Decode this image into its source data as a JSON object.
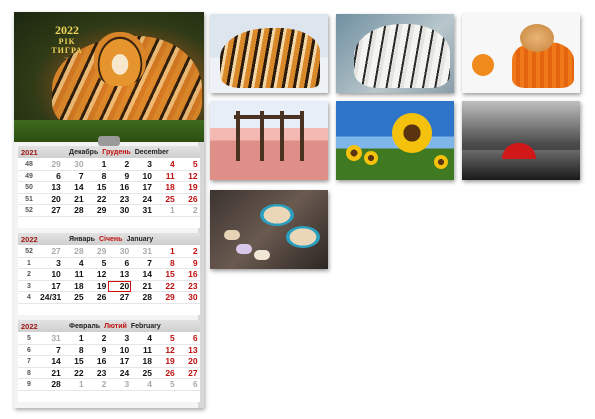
{
  "calendar": {
    "header": {
      "year": "2022",
      "line1": "РІК",
      "line2": "ТИГРА",
      "small": "~•~"
    },
    "months": [
      {
        "year": "2021",
        "name_ru": "Декабрь",
        "name_ua": "Грудень",
        "name_en": "December",
        "weeks": [
          {
            "week": "48",
            "days": [
              "29",
              "30",
              "1",
              "2",
              "3",
              "4",
              "5"
            ]
          },
          {
            "week": "49",
            "days": [
              "6",
              "7",
              "8",
              "9",
              "10",
              "11",
              "12"
            ]
          },
          {
            "week": "50",
            "days": [
              "13",
              "14",
              "15",
              "16",
              "17",
              "18",
              "19"
            ]
          },
          {
            "week": "51",
            "days": [
              "20",
              "21",
              "22",
              "23",
              "24",
              "25",
              "26"
            ]
          },
          {
            "week": "52",
            "days": [
              "27",
              "28",
              "29",
              "30",
              "31",
              "1",
              "2"
            ]
          }
        ]
      },
      {
        "year": "2022",
        "name_ru": "Январь",
        "name_ua": "Січень",
        "name_en": "January",
        "weeks": [
          {
            "week": "52",
            "days": [
              "27",
              "28",
              "29",
              "30",
              "31",
              "1",
              "2"
            ]
          },
          {
            "week": "1",
            "days": [
              "3",
              "4",
              "5",
              "6",
              "7",
              "8",
              "9"
            ]
          },
          {
            "week": "2",
            "days": [
              "10",
              "11",
              "12",
              "13",
              "14",
              "15",
              "16"
            ]
          },
          {
            "week": "3",
            "days": [
              "17",
              "18",
              "19",
              "20",
              "21",
              "22",
              "23"
            ]
          },
          {
            "week": "4",
            "days": [
              "24/31",
              "25",
              "26",
              "27",
              "28",
              "29",
              "30"
            ]
          }
        ]
      },
      {
        "year": "2022",
        "name_ru": "Февраль",
        "name_ua": "Лютий",
        "name_en": "February",
        "weeks": [
          {
            "week": "5",
            "days": [
              "31",
              "1",
              "2",
              "3",
              "4",
              "5",
              "6"
            ]
          },
          {
            "week": "6",
            "days": [
              "7",
              "8",
              "9",
              "10",
              "11",
              "12",
              "13"
            ]
          },
          {
            "week": "7",
            "days": [
              "14",
              "15",
              "16",
              "17",
              "18",
              "19",
              "20"
            ]
          },
          {
            "week": "8",
            "days": [
              "21",
              "22",
              "23",
              "24",
              "25",
              "26",
              "27"
            ]
          },
          {
            "week": "9",
            "days": [
              "28",
              "1",
              "2",
              "3",
              "4",
              "5",
              "6"
            ]
          }
        ]
      }
    ]
  },
  "colors": {
    "accent": "#c01010",
    "gray_day": "#aaaaaa"
  },
  "thumbnails": [
    "tiger-on-snow",
    "white-tiger",
    "kitten-in-sweater",
    "pink-lake-pier",
    "sunflowers",
    "rainy-street-red-umbrella",
    "coffee-and-macarons"
  ]
}
